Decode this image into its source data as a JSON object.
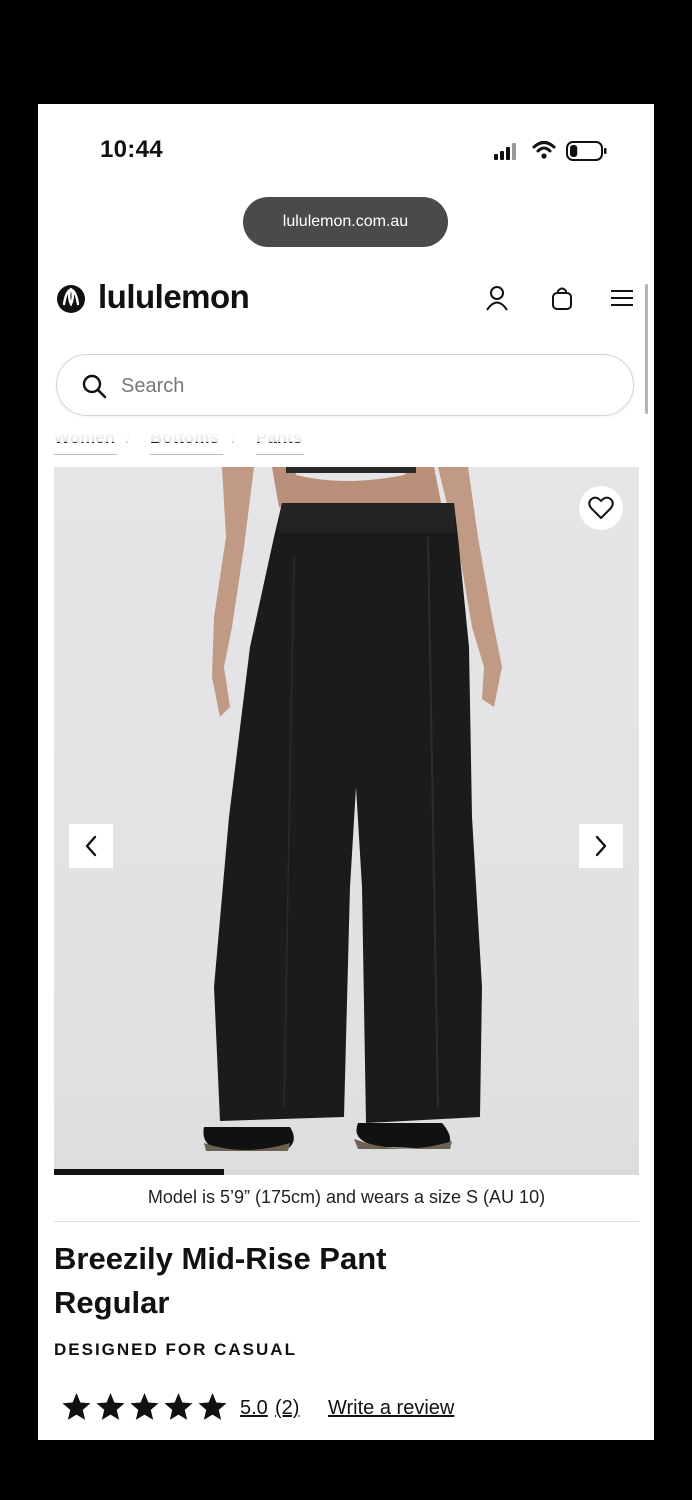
{
  "status_bar": {
    "time": "10:44",
    "battery_level": 0.25
  },
  "browser": {
    "url": "lululemon.com.au"
  },
  "header": {
    "brand": "lululemon",
    "icons": [
      "account-icon",
      "bag-icon",
      "menu-icon"
    ]
  },
  "search": {
    "placeholder": "Search",
    "value": ""
  },
  "breadcrumb": [
    "Women",
    "Bottoms",
    "Pants"
  ],
  "gallery": {
    "favorite_icon": "heart-icon",
    "prev_icon": "chevron-left-icon",
    "next_icon": "chevron-right-icon",
    "progress": 0.29
  },
  "product": {
    "model_note": "Model is 5’9” (175cm) and wears a size S (AU 10)",
    "title_line1": "Breezily Mid-Rise Pant",
    "title_line2": "Regular",
    "designed_for": "DESIGNED FOR CASUAL",
    "rating": {
      "stars": 5,
      "value": "5.0",
      "count": "(2)",
      "write_review": "Write a review"
    }
  },
  "colors": {
    "text": "#111111",
    "pill": "#4a4a4a",
    "image_bg": "#e4e4e6",
    "pant": "#1b1b1c"
  }
}
